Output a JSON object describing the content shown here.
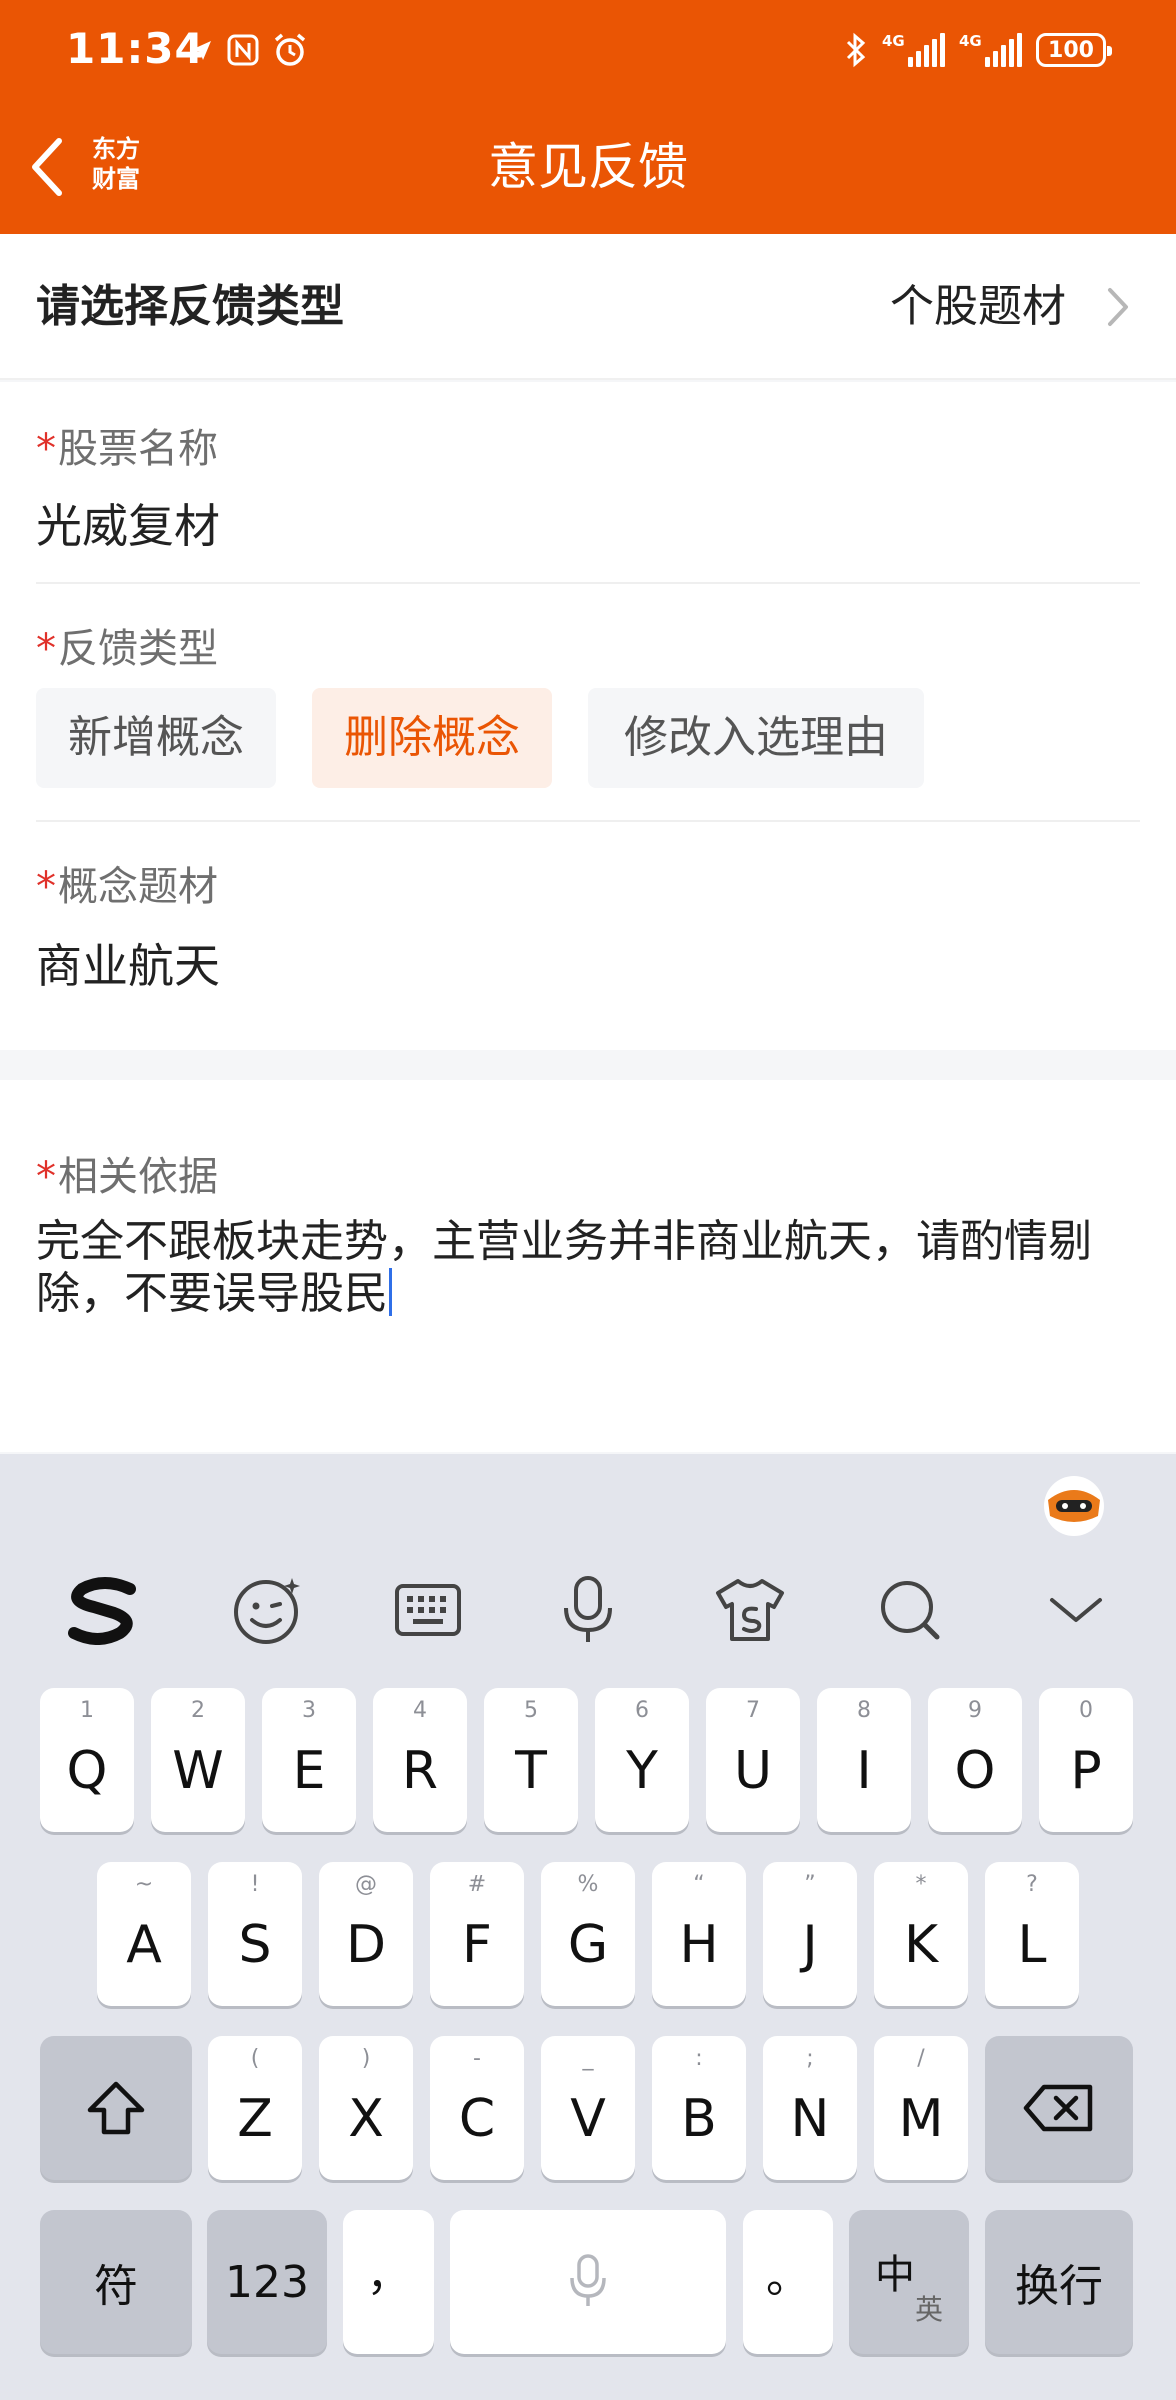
{
  "status_bar": {
    "time": "11:34",
    "battery": "100",
    "signal_1": "4G",
    "signal_2": "4G"
  },
  "nav": {
    "title": "意见反馈",
    "logo_line1": "东方",
    "logo_line2": "财富"
  },
  "feedback_type_row": {
    "label": "请选择反馈类型",
    "value": "个股题材"
  },
  "form": {
    "required_mark": "*",
    "stock_name_label": "股票名称",
    "stock_name_value": "光威复材",
    "feedback_type_label": "反馈类型",
    "options": [
      {
        "label": "新增概念",
        "selected": false
      },
      {
        "label": "删除概念",
        "selected": true
      },
      {
        "label": "修改入选理由",
        "selected": false
      }
    ],
    "concept_label": "概念题材",
    "concept_value": "商业航天",
    "basis_label": "相关依据",
    "basis_value": "完全不跟板块走势，主营业务并非商业航天，请酌情剔除，不要误导股民"
  },
  "keyboard": {
    "row1": [
      {
        "hint": "1",
        "key": "Q"
      },
      {
        "hint": "2",
        "key": "W"
      },
      {
        "hint": "3",
        "key": "E"
      },
      {
        "hint": "4",
        "key": "R"
      },
      {
        "hint": "5",
        "key": "T"
      },
      {
        "hint": "6",
        "key": "Y"
      },
      {
        "hint": "7",
        "key": "U"
      },
      {
        "hint": "8",
        "key": "I"
      },
      {
        "hint": "9",
        "key": "O"
      },
      {
        "hint": "0",
        "key": "P"
      }
    ],
    "row2": [
      {
        "hint": "~",
        "key": "A"
      },
      {
        "hint": "!",
        "key": "S"
      },
      {
        "hint": "@",
        "key": "D"
      },
      {
        "hint": "#",
        "key": "F"
      },
      {
        "hint": "%",
        "key": "G"
      },
      {
        "hint": "“",
        "key": "H"
      },
      {
        "hint": "”",
        "key": "J"
      },
      {
        "hint": "*",
        "key": "K"
      },
      {
        "hint": "?",
        "key": "L"
      }
    ],
    "row3": [
      {
        "hint": "(",
        "key": "Z"
      },
      {
        "hint": ")",
        "key": "X"
      },
      {
        "hint": "-",
        "key": "C"
      },
      {
        "hint": "_",
        "key": "V"
      },
      {
        "hint": ":",
        "key": "B"
      },
      {
        "hint": ";",
        "key": "N"
      },
      {
        "hint": "/",
        "key": "M"
      }
    ],
    "symbol_key": "符",
    "number_key": "123",
    "comma_key": "，",
    "period_key": "。",
    "lang_key_main": "中",
    "lang_key_sub": "英",
    "enter_key": "换行"
  },
  "colors": {
    "brand": "#ea5504",
    "required": "#e0312a",
    "chip_selected_bg": "#fdeee6"
  }
}
